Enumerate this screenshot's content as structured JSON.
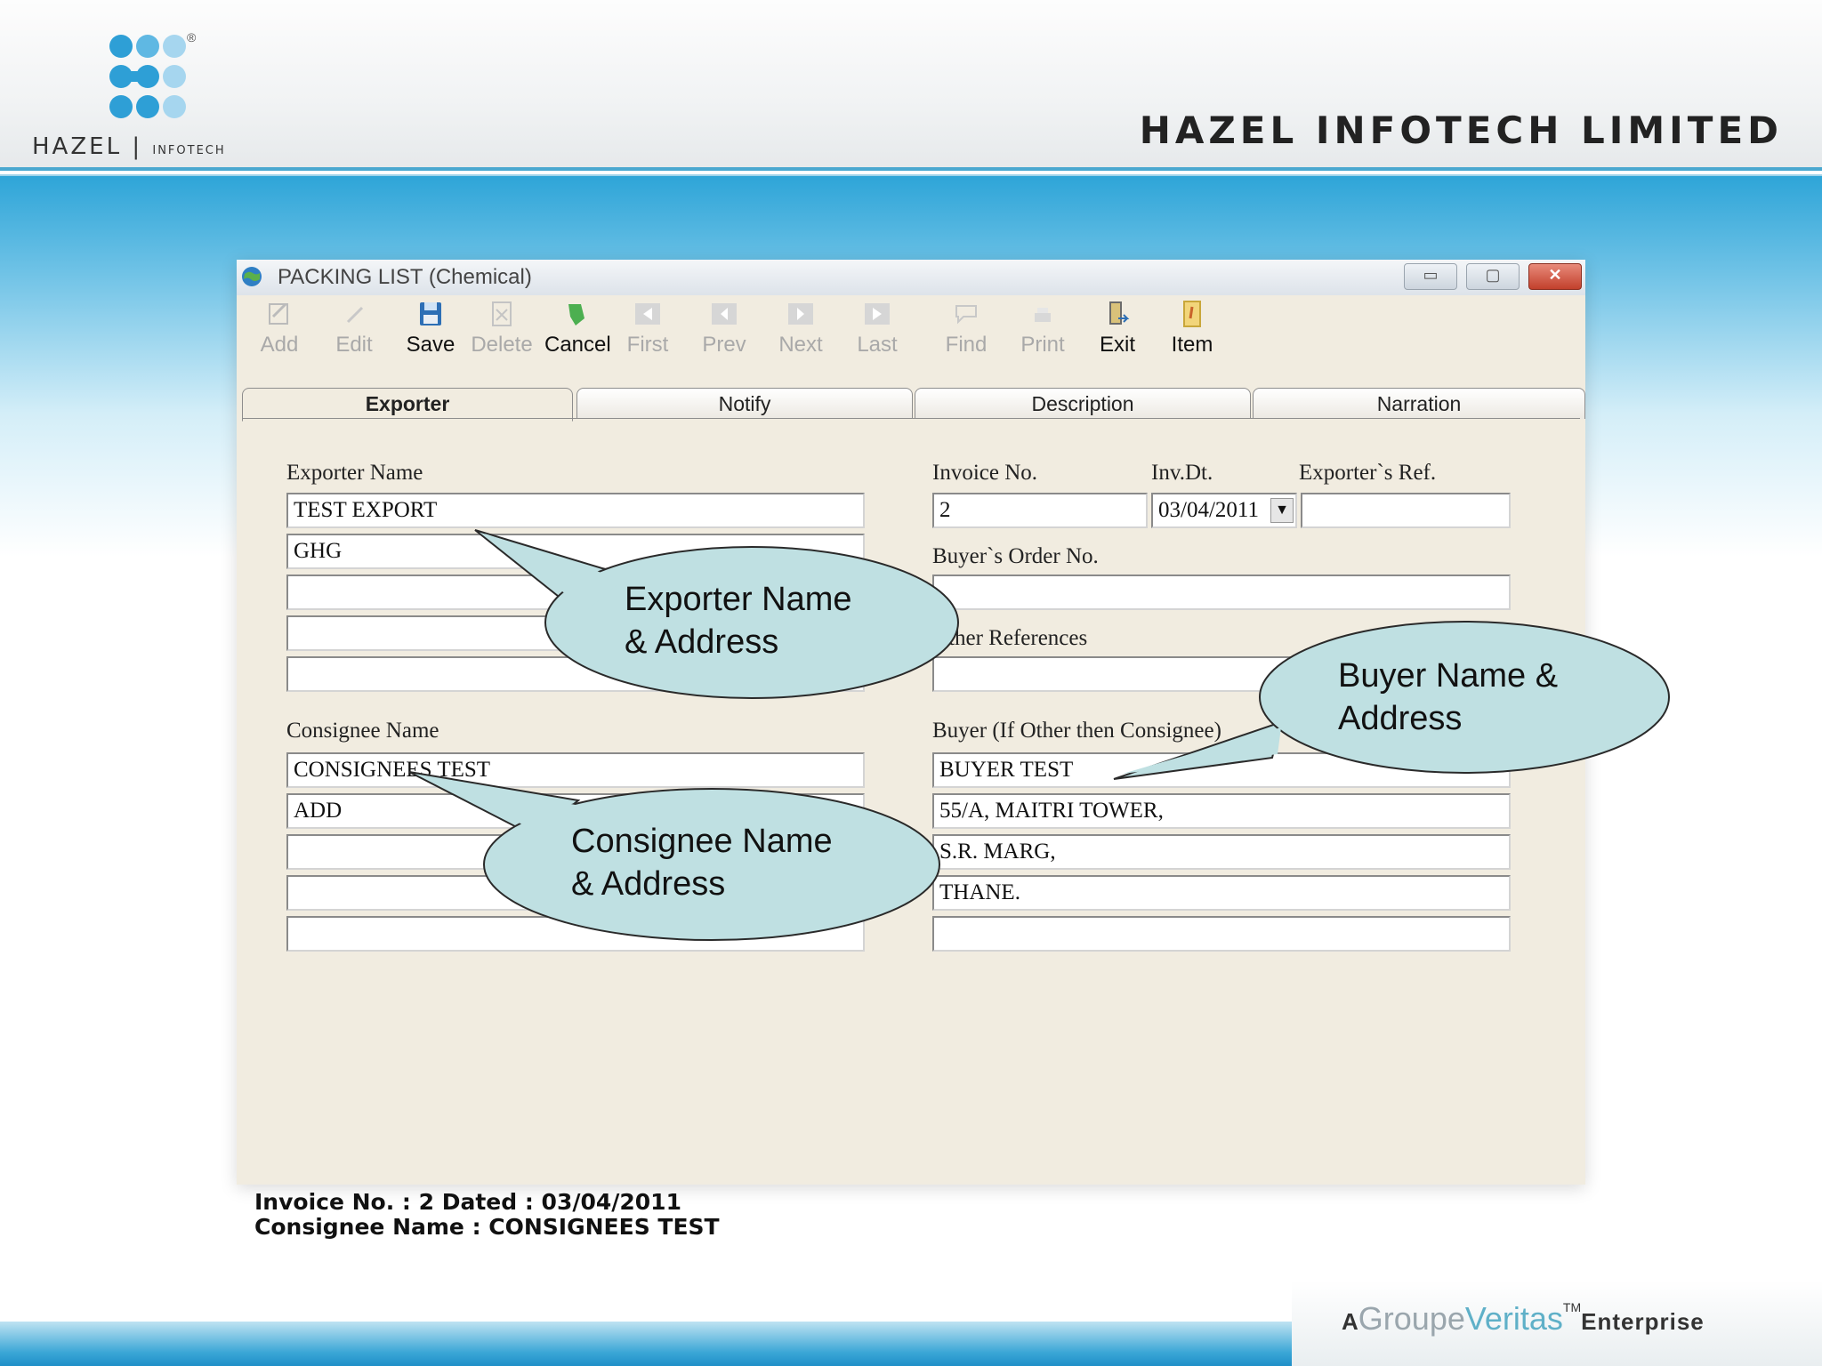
{
  "header": {
    "logo_text": "HAZEL",
    "logo_subtext": "INFOTECH",
    "logo_registered": "®",
    "company_name": "HAZEL INFOTECH LIMITED"
  },
  "window": {
    "title": "PACKING LIST (Chemical)",
    "minimize": "▭",
    "restore": "▢",
    "close": "✕"
  },
  "toolbar": {
    "add": "Add",
    "edit": "Edit",
    "save": "Save",
    "delete": "Delete",
    "cancel": "Cancel",
    "first": "First",
    "prev": "Prev",
    "next": "Next",
    "last": "Last",
    "find": "Find",
    "print": "Print",
    "exit": "Exit",
    "item": "Item"
  },
  "tabs": {
    "exporter": "Exporter",
    "notify": "Notify",
    "description": "Description",
    "narration": "Narration"
  },
  "form": {
    "exporter_name_label": "Exporter Name",
    "exporter_lines": [
      "TEST EXPORT",
      "GHG",
      "",
      "",
      ""
    ],
    "consignee_name_label": "Consignee Name",
    "consignee_lines": [
      "CONSIGNEES TEST",
      "ADD",
      "",
      "",
      ""
    ],
    "invoice_no_label": "Invoice No.",
    "invoice_no": "2",
    "inv_dt_label": "Inv.Dt.",
    "inv_dt": "03/04/2011",
    "exporters_ref_label": "Exporter`s Ref.",
    "exporters_ref": "",
    "buyers_order_label": "Buyer`s Order No.",
    "buyers_order": "",
    "other_references_label": "Other References",
    "other_references": "",
    "buyer_label": "Buyer (If Other then Consignee)",
    "buyer_lines": [
      "BUYER TEST",
      "55/A, MAITRI TOWER,",
      "S.R. MARG,",
      "THANE.",
      ""
    ]
  },
  "status": {
    "line1": "Invoice No. : 2   Dated : 03/04/2011",
    "line2": "Consignee Name : CONSIGNEES TEST"
  },
  "callouts": {
    "exporter": [
      "Exporter Name",
      "& Address"
    ],
    "consignee": [
      "Consignee Name",
      "& Address"
    ],
    "buyer": [
      "Buyer Name &",
      "Address"
    ]
  },
  "footer": {
    "a": "A",
    "groupe": "Groupe",
    "veritas": "Veritas",
    "tm": "TM",
    "enterprise": "Enterprise"
  },
  "colors": {
    "brand_blue": "#2ea5d8",
    "window_bg": "#f1ece0",
    "callout_fill": "#bfe0e2"
  }
}
